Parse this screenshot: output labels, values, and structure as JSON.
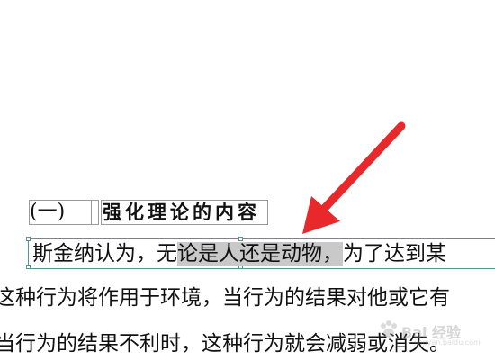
{
  "document": {
    "heading": {
      "number": "(一)",
      "title": "强化理论的内容"
    },
    "paragraph": {
      "line1_before": "斯金纳认为，无",
      "line1_selected": "论是人还是动物，",
      "line1_after": "为了达到某",
      "line2": "这种行为将作用于环境，当行为的结果对他或它有",
      "line3": "当行为的结果不利时，这种行为就会减弱或消失。"
    }
  },
  "annotation": {
    "type": "arrow",
    "color": "#e8282b"
  },
  "watermark": {
    "text": "Bai 经验",
    "sub": "jingyan.baidu.com"
  }
}
